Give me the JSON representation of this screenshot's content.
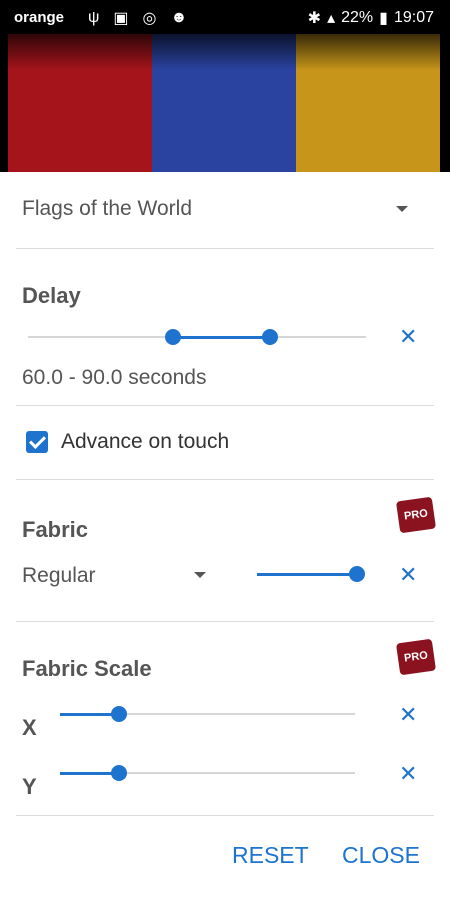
{
  "status_bar": {
    "carrier": "orange",
    "battery": "22%",
    "time": "19:07"
  },
  "theme_selector": {
    "label": "Flags of the World"
  },
  "delay": {
    "title": "Delay",
    "range_text": "60.0 - 90.0 seconds",
    "min": 60.0,
    "max": 90.0
  },
  "advance_on_touch": {
    "label": "Advance on touch",
    "checked": true
  },
  "fabric": {
    "title": "Fabric",
    "type": "Regular",
    "slider_value": 1.0,
    "pro_badge": "PRO"
  },
  "fabric_scale": {
    "title": "Fabric Scale",
    "x_label": "X",
    "y_label": "Y",
    "x_value": 0.2,
    "y_value": 0.2,
    "pro_badge": "PRO"
  },
  "actions": {
    "reset": "RESET",
    "close": "CLOSE"
  }
}
